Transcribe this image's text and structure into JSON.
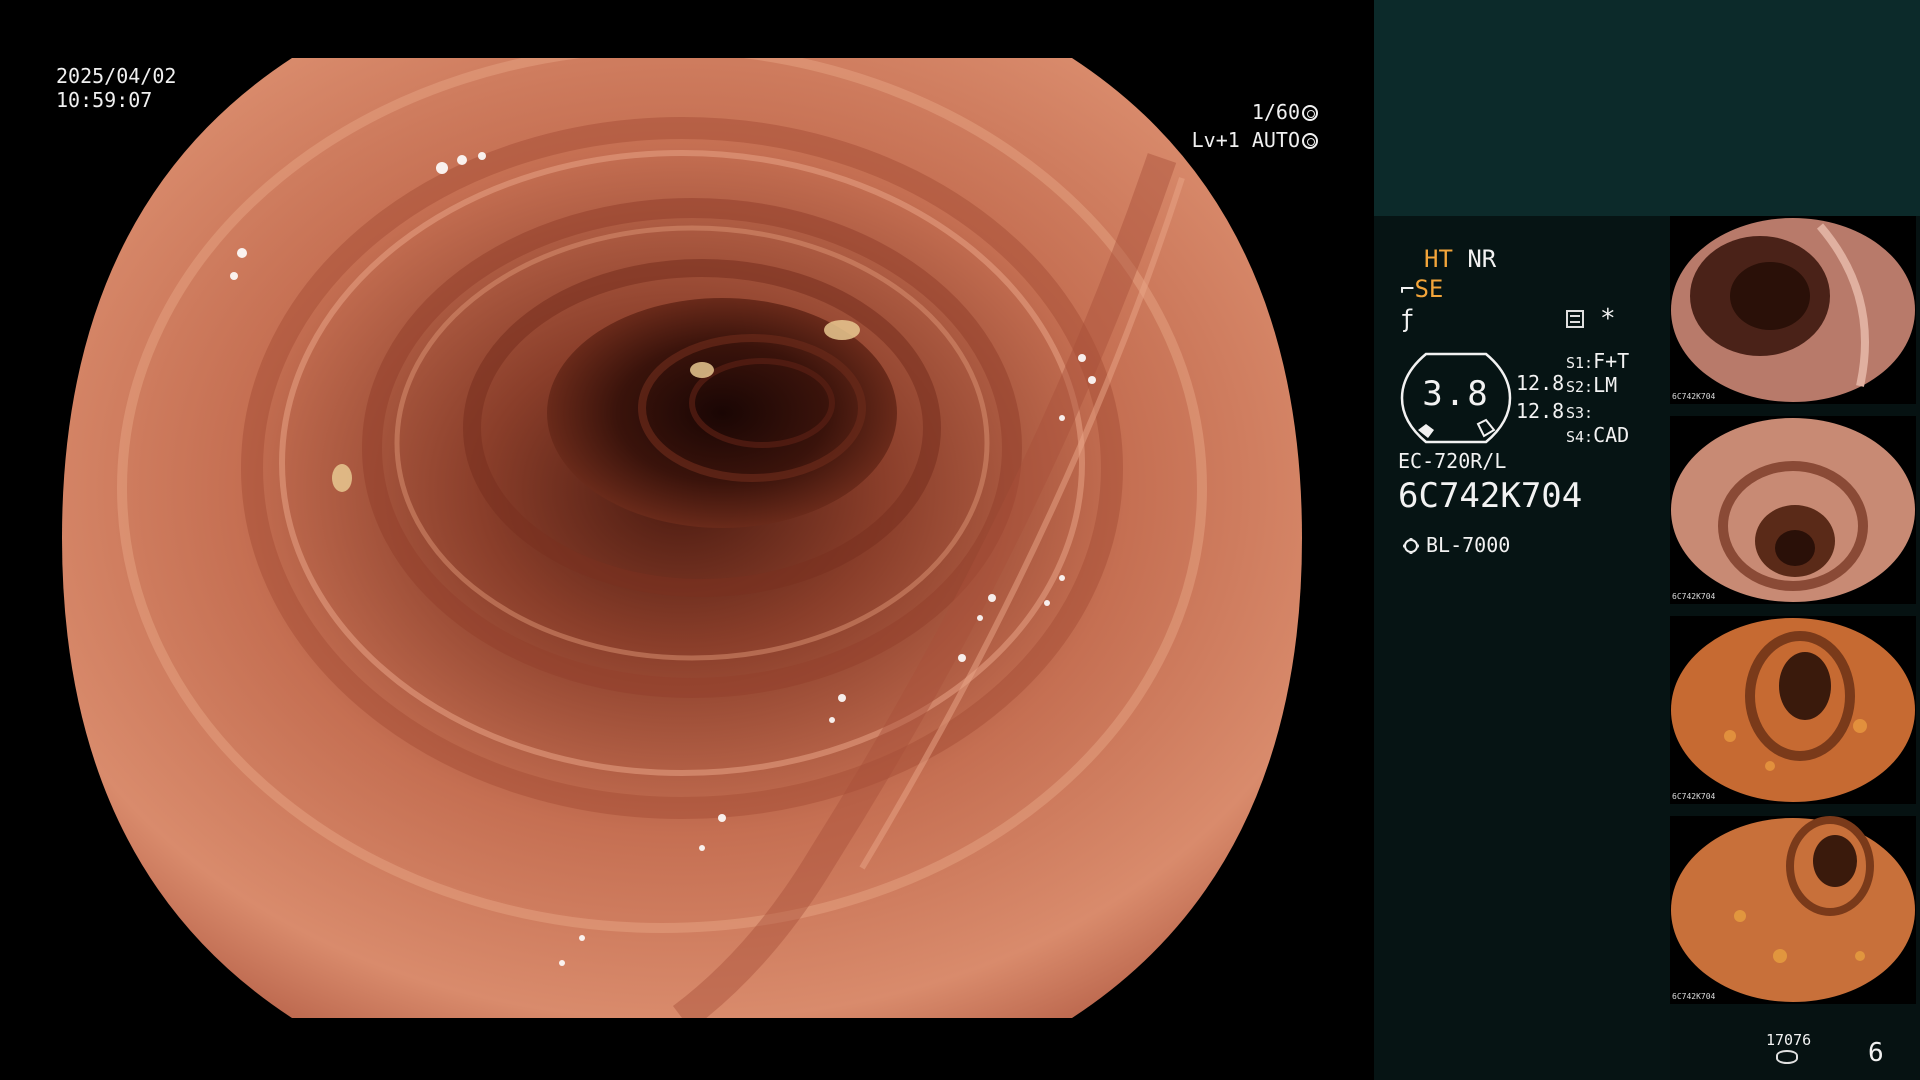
{
  "osd": {
    "date": "2025/04/02",
    "time": "10:59:07",
    "shutter": "1/60",
    "level": "Lv+1 AUTO",
    "shutter_icon": "shutter-icon",
    "auto_icon": "auto-iris-icon"
  },
  "panel": {
    "ht": "HT",
    "nr": "NR",
    "se": "SE",
    "se_icon": "se-enhancement-icon",
    "filter_icon": "filter-icon",
    "struct_icon": "structure-enhancement-icon",
    "asterisk": "*",
    "gauge_value": "3.8",
    "range_a": "12.8",
    "range_b": "12.8",
    "switches": [
      {
        "tag": "S1:",
        "value": "F+T"
      },
      {
        "tag": "S2:",
        "value": "LM"
      },
      {
        "tag": "S3:",
        "value": ""
      },
      {
        "tag": "S4:",
        "value": "CAD"
      }
    ],
    "scope_model": "EC-720R/L",
    "scope_serial": "6C742K704",
    "light_source": "BL-7000",
    "light_icon": "light-source-icon",
    "counter": "17076",
    "disk_icon": "storage-icon",
    "page_number": "6"
  },
  "thumbnails": [
    {
      "label": "6C742K704"
    },
    {
      "label": "6C742K704"
    },
    {
      "label": "6C742K704"
    },
    {
      "label": "6C742K704"
    }
  ]
}
